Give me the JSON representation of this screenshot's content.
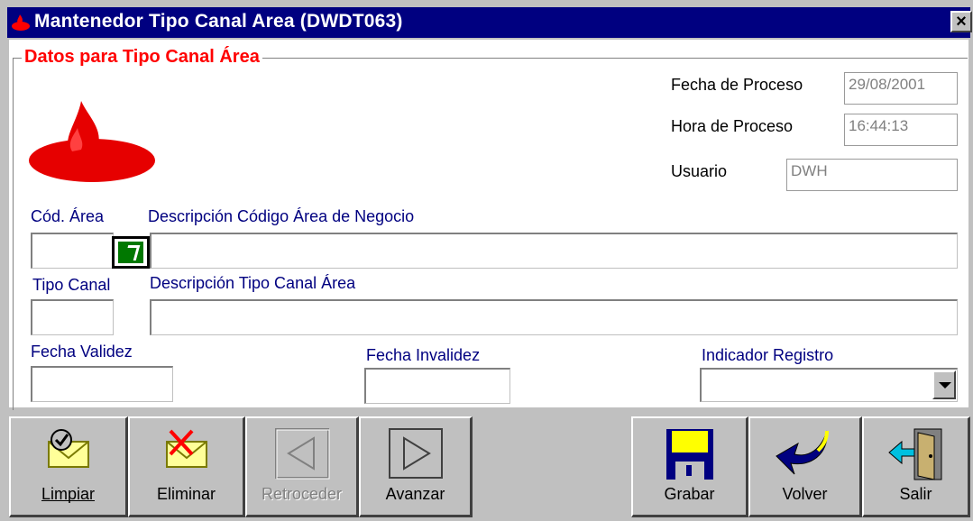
{
  "window": {
    "title": "Mantenedor Tipo Canal Area (DWDT063)",
    "close_glyph": "×"
  },
  "group": {
    "legend": "Datos para Tipo Canal Área"
  },
  "process": {
    "fecha_label": "Fecha de Proceso",
    "fecha_value": "29/08/2001",
    "hora_label": "Hora de Proceso",
    "hora_value": "16:44:13",
    "usuario_label": "Usuario",
    "usuario_value": "DWH"
  },
  "form": {
    "cod_area_label": "Cód. Área",
    "cod_area_value": "",
    "desc_area_label": "Descripción Código Área de Negocio",
    "desc_area_value": "",
    "tipo_canal_label": "Tipo Canal",
    "tipo_canal_value": "",
    "desc_tipo_label": "Descripción Tipo Canal Área",
    "desc_tipo_value": "",
    "fecha_validez_label": "Fecha Validez",
    "fecha_validez_value": "",
    "fecha_invalidez_label": "Fecha Invalidez",
    "fecha_invalidez_value": "",
    "indicador_label": "Indicador Registro",
    "indicador_value": ""
  },
  "buttons": {
    "limpiar": "Limpiar",
    "eliminar": "Eliminar",
    "retroceder": "Retroceder",
    "avanzar": "Avanzar",
    "grabar": "Grabar",
    "volver": "Volver",
    "salir": "Salir"
  },
  "icons": {
    "title": "santander-flame-icon",
    "logo": "santander-logo",
    "lookup": "lookup-check-icon",
    "limpiar": "envelope-check-icon",
    "eliminar": "envelope-cross-icon",
    "retroceder": "arrow-left-icon",
    "avanzar": "arrow-right-icon",
    "grabar": "floppy-disk-icon",
    "volver": "curved-arrow-back-icon",
    "salir": "exit-door-icon"
  },
  "colors": {
    "title_bg": "#000080",
    "legend": "#ff0000",
    "label": "#000080"
  }
}
